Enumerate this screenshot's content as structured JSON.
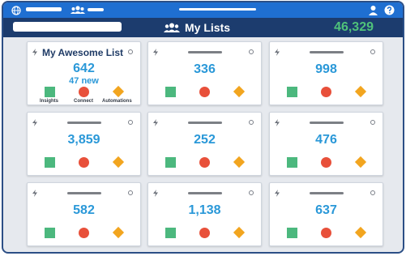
{
  "header": {
    "title": "My Lists",
    "count": "46,329"
  },
  "colors": {
    "topbar": "#1f6fd1",
    "header": "#1c3c6e",
    "count": "#4fc27a",
    "value": "#2a98d8",
    "insights": "#4cb87e",
    "connect": "#e8503a",
    "automations": "#f2a51f"
  },
  "cards": [
    {
      "title": "My Awesome List",
      "value": "642",
      "new": "47 new",
      "labels": {
        "insights": "Insights",
        "connect": "Connect",
        "automations": "Automations"
      }
    },
    {
      "value": "336"
    },
    {
      "value": "998"
    },
    {
      "value": "3,859"
    },
    {
      "value": "252"
    },
    {
      "value": "476"
    },
    {
      "value": "582"
    },
    {
      "value": "1,138"
    },
    {
      "value": "637"
    }
  ]
}
